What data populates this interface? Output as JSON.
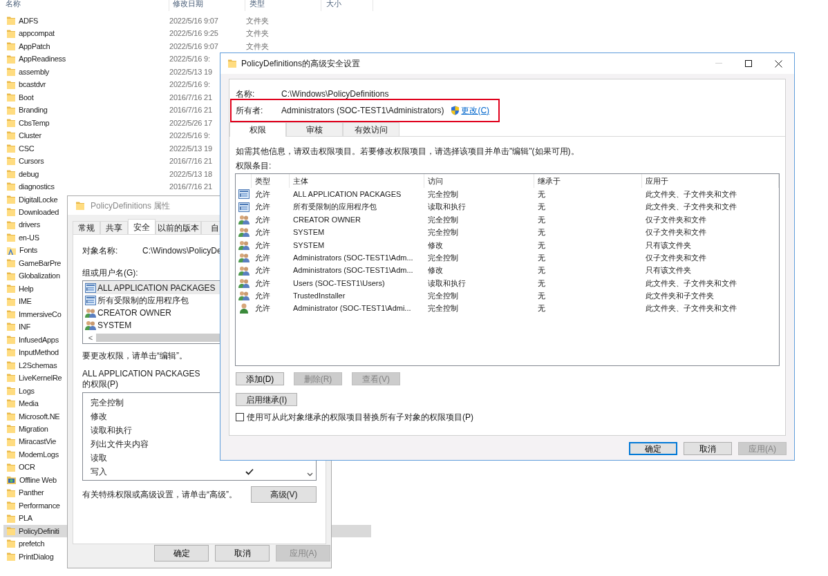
{
  "explorer": {
    "columns": [
      "名称",
      "修改日期",
      "类型",
      "大小"
    ],
    "rows": [
      {
        "kind": "folder",
        "name": "ADFS",
        "date": "2022/5/16 9:07",
        "type": "文件夹",
        "selected": false
      },
      {
        "kind": "folder",
        "name": "appcompat",
        "date": "2022/5/16 9:25",
        "type": "文件夹",
        "selected": false
      },
      {
        "kind": "folder",
        "name": "AppPatch",
        "date": "2022/5/16 9:07",
        "type": "文件夹",
        "selected": false
      },
      {
        "kind": "folder",
        "name": "AppReadiness",
        "date": "2022/5/16 9:",
        "selected": false
      },
      {
        "kind": "folder",
        "name": "assembly",
        "date": "2022/5/13 19",
        "selected": false
      },
      {
        "kind": "folder",
        "name": "bcastdvr",
        "date": "2022/5/16 9:",
        "selected": false
      },
      {
        "kind": "folder",
        "name": "Boot",
        "date": "2016/7/16 21",
        "selected": false
      },
      {
        "kind": "folder",
        "name": "Branding",
        "date": "2016/7/16 21",
        "selected": false
      },
      {
        "kind": "folder",
        "name": "CbsTemp",
        "date": "2022/5/26 17",
        "selected": false
      },
      {
        "kind": "folder",
        "name": "Cluster",
        "date": "2022/5/16 9:",
        "selected": false
      },
      {
        "kind": "folder",
        "name": "CSC",
        "date": "2022/5/13 19",
        "selected": false
      },
      {
        "kind": "folder",
        "name": "Cursors",
        "date": "2016/7/16 21",
        "selected": false
      },
      {
        "kind": "folder",
        "name": "debug",
        "date": "2022/5/13 18",
        "selected": false
      },
      {
        "kind": "folder",
        "name": "diagnostics",
        "date": "2016/7/16 21",
        "selected": false
      },
      {
        "kind": "folder",
        "name": "DigitalLocke",
        "selected": false
      },
      {
        "kind": "folder",
        "name": "Downloaded",
        "selected": false
      },
      {
        "kind": "folder",
        "name": "drivers",
        "selected": false
      },
      {
        "kind": "folder",
        "name": "en-US",
        "selected": false
      },
      {
        "kind": "font-folder",
        "name": "Fonts",
        "selected": false
      },
      {
        "kind": "folder",
        "name": "GameBarPre",
        "selected": false
      },
      {
        "kind": "folder",
        "name": "Globalization",
        "selected": false
      },
      {
        "kind": "folder",
        "name": "Help",
        "selected": false
      },
      {
        "kind": "folder",
        "name": "IME",
        "selected": false
      },
      {
        "kind": "folder",
        "name": "ImmersiveCo",
        "selected": false
      },
      {
        "kind": "folder",
        "name": "INF",
        "selected": false
      },
      {
        "kind": "folder",
        "name": "InfusedApps",
        "selected": false
      },
      {
        "kind": "folder",
        "name": "InputMethod",
        "selected": false
      },
      {
        "kind": "folder",
        "name": "L2Schemas",
        "selected": false
      },
      {
        "kind": "folder",
        "name": "LiveKernelRe",
        "selected": false
      },
      {
        "kind": "folder",
        "name": "Logs",
        "selected": false
      },
      {
        "kind": "folder",
        "name": "Media",
        "selected": false
      },
      {
        "kind": "folder",
        "name": "Microsoft.NE",
        "selected": false
      },
      {
        "kind": "folder",
        "name": "Migration",
        "selected": false
      },
      {
        "kind": "folder",
        "name": "MiracastVie",
        "selected": false
      },
      {
        "kind": "folder",
        "name": "ModemLogs",
        "selected": false
      },
      {
        "kind": "folder",
        "name": "OCR",
        "selected": false
      },
      {
        "kind": "web-folder",
        "name": "Offline Web",
        "selected": false
      },
      {
        "kind": "folder",
        "name": "Panther",
        "selected": false
      },
      {
        "kind": "folder",
        "name": "Performance",
        "selected": false
      },
      {
        "kind": "folder",
        "name": "PLA",
        "selected": false
      },
      {
        "kind": "folder",
        "name": "PolicyDefiniti",
        "selected": true
      },
      {
        "kind": "folder",
        "name": "prefetch",
        "selected": false
      },
      {
        "kind": "folder",
        "name": "PrintDialog",
        "selected": false
      }
    ]
  },
  "properties": {
    "title": "PolicyDefinitions 属性",
    "tabs": [
      {
        "label": "常规",
        "selected": false
      },
      {
        "label": "共享",
        "selected": false
      },
      {
        "label": "安全",
        "selected": true
      },
      {
        "label": "以前的版本",
        "selected": false
      },
      {
        "label": "自",
        "selected": false
      }
    ],
    "object_label": "对象名称:",
    "object_value": "C:\\Windows\\PolicyDe",
    "groups_label": "组或用户名(G):",
    "groups": [
      {
        "kind": "package",
        "name": "ALL APPLICATION PACKAGES",
        "selected": true
      },
      {
        "kind": "package",
        "name": "所有受限制的应用程序包",
        "selected": false
      },
      {
        "kind": "group",
        "name": "CREATOR OWNER",
        "selected": false
      },
      {
        "kind": "group",
        "name": "SYSTEM",
        "selected": false
      }
    ],
    "scroll_left": "<",
    "edit_hint": "要更改权限，请单击“编辑”。",
    "permissions_label": "ALL APPLICATION PACKAGES 的权限(P)",
    "permissions": [
      {
        "name": "完全控制"
      },
      {
        "name": "修改"
      },
      {
        "name": "读取和执行"
      },
      {
        "name": "列出文件夹内容"
      },
      {
        "name": "读取"
      },
      {
        "name": "写入",
        "checked": true
      }
    ],
    "advanced_hint": "有关特殊权限或高级设置，请单击“高级”。",
    "advanced_button": "高级(V)",
    "buttons": [
      {
        "label": "确定",
        "disabled": false
      },
      {
        "label": "取消",
        "disabled": false
      },
      {
        "label": "应用(A)",
        "disabled": true
      }
    ]
  },
  "advanced": {
    "title": "PolicyDefinitions的高级安全设置",
    "name_label": "名称:",
    "name_value": "C:\\Windows\\PolicyDefinitions",
    "owner": {
      "label": "所有者:",
      "value": "Administrators (SOC-TEST1\\Administrators)",
      "link": "更改(C)",
      "highlighted": true
    },
    "tabs": [
      {
        "label": "权限",
        "selected": true
      },
      {
        "label": "审核",
        "selected": false
      },
      {
        "label": "有效访问",
        "selected": false
      }
    ],
    "info": "如需其他信息，请双击权限项目。若要修改权限项目，请选择该项目并单击\"编辑\"(如果可用)。",
    "entries_label": "权限条目:",
    "table": {
      "columns": [
        "类型",
        "主体",
        "访问",
        "继承于",
        "应用于"
      ],
      "rows": [
        {
          "kind": "package",
          "type": "允许",
          "principal": "ALL APPLICATION PACKAGES",
          "access": "完全控制",
          "inherited": "无",
          "applies": "此文件夹、子文件夹和文件"
        },
        {
          "kind": "package",
          "type": "允许",
          "principal": "所有受限制的应用程序包",
          "access": "读取和执行",
          "inherited": "无",
          "applies": "此文件夹、子文件夹和文件"
        },
        {
          "kind": "group",
          "type": "允许",
          "principal": "CREATOR OWNER",
          "access": "完全控制",
          "inherited": "无",
          "applies": "仅子文件夹和文件"
        },
        {
          "kind": "group",
          "type": "允许",
          "principal": "SYSTEM",
          "access": "完全控制",
          "inherited": "无",
          "applies": "仅子文件夹和文件"
        },
        {
          "kind": "group",
          "type": "允许",
          "principal": "SYSTEM",
          "access": "修改",
          "inherited": "无",
          "applies": "只有该文件夹"
        },
        {
          "kind": "group",
          "type": "允许",
          "principal": "Administrators (SOC-TEST1\\Adm...",
          "access": "完全控制",
          "inherited": "无",
          "applies": "仅子文件夹和文件"
        },
        {
          "kind": "group",
          "type": "允许",
          "principal": "Administrators (SOC-TEST1\\Adm...",
          "access": "修改",
          "inherited": "无",
          "applies": "只有该文件夹"
        },
        {
          "kind": "group",
          "type": "允许",
          "principal": "Users (SOC-TEST1\\Users)",
          "access": "读取和执行",
          "inherited": "无",
          "applies": "此文件夹、子文件夹和文件"
        },
        {
          "kind": "group",
          "type": "允许",
          "principal": "TrustedInstaller",
          "access": "完全控制",
          "inherited": "无",
          "applies": "此文件夹和子文件夹"
        },
        {
          "kind": "user",
          "type": "允许",
          "principal": "Administrator (SOC-TEST1\\Admi...",
          "access": "完全控制",
          "inherited": "无",
          "applies": "此文件夹、子文件夹和文件"
        }
      ]
    },
    "entry_buttons": [
      {
        "label": "添加(D)",
        "disabled": false
      },
      {
        "label": "删除(R)",
        "disabled": true
      },
      {
        "label": "查看(V)",
        "disabled": true
      }
    ],
    "inherit_button": "启用继承(I)",
    "replace_checkbox": {
      "label": "使用可从此对象继承的权限项目替换所有子对象的权限项目(P)",
      "checked": false
    },
    "buttons": [
      {
        "label": "确定",
        "disabled": false,
        "default": true
      },
      {
        "label": "取消",
        "disabled": false,
        "default": false
      },
      {
        "label": "应用(A)",
        "disabled": true,
        "default": false
      }
    ]
  }
}
